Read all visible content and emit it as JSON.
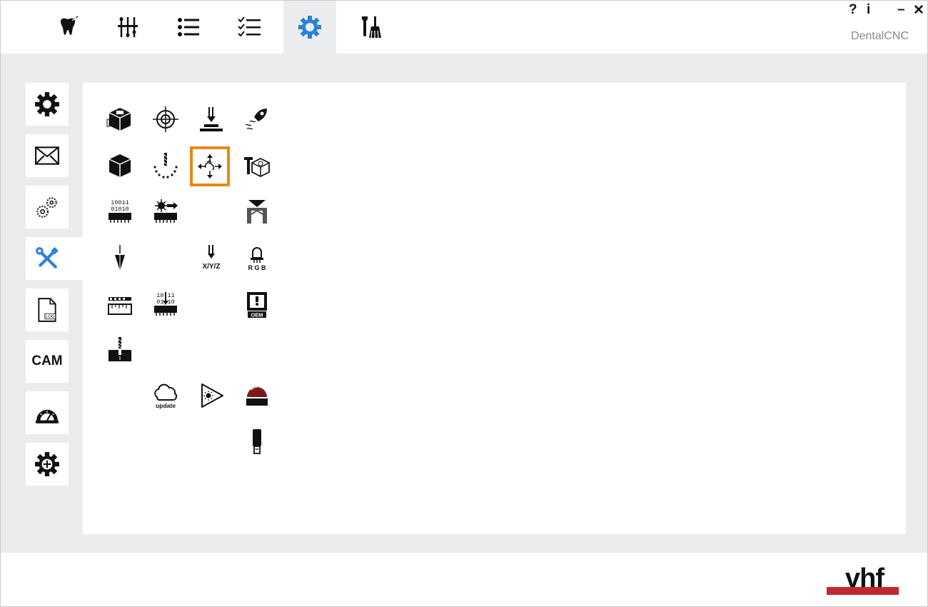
{
  "app": {
    "name": "DentalCNC"
  },
  "window_controls": {
    "help": "?",
    "info": "i",
    "minimize": "–",
    "close": "✕"
  },
  "top_tabs": [
    {
      "icon": "tooth-icon"
    },
    {
      "icon": "sliders-icon"
    },
    {
      "icon": "list-icon"
    },
    {
      "icon": "checklist-icon"
    },
    {
      "icon": "gear-icon",
      "active": true
    },
    {
      "icon": "maintenance-tools-icon"
    }
  ],
  "sidebar": {
    "items": [
      {
        "icon": "gear-icon"
      },
      {
        "icon": "envelope-icon"
      },
      {
        "icon": "gears-icon"
      },
      {
        "icon": "tools-icon",
        "active": true
      },
      {
        "icon": "log-file-icon",
        "label": "LOG"
      },
      {
        "label": "CAM"
      },
      {
        "icon": "protractor-icon"
      },
      {
        "icon": "gear-plus-icon"
      }
    ]
  },
  "panel": {
    "labels": {
      "bin_a": "10011",
      "bin_b": "01010",
      "bin_c": "10 11",
      "bin_d": "01 10",
      "xyz": "X/Y/Z",
      "rgb": "R G B",
      "oem": "OEM",
      "update": "update",
      "log": "LOG"
    },
    "selected": "axis-move-icon"
  },
  "colors": {
    "accent": "#2b82d9",
    "selection": "#e48a16",
    "brand": "#c22730",
    "background": "#ebecee"
  },
  "footer": {
    "logo": "vhf"
  }
}
